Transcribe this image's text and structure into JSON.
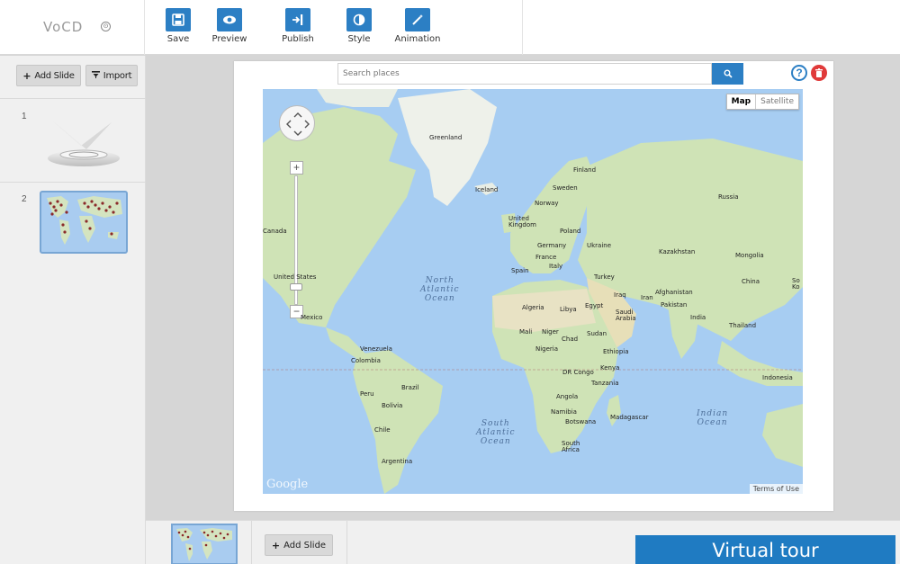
{
  "app": {
    "logo_text": "VoCD",
    "logo_caret": "⊙"
  },
  "toolbar": {
    "save_label": "Save",
    "preview_label": "Preview",
    "publish_label": "Publish",
    "style_label": "Style",
    "animation_label": "Animation"
  },
  "sidebar": {
    "add_slide_label": "Add Slide",
    "import_label": "Import",
    "slides": [
      {
        "number": "1"
      },
      {
        "number": "2"
      }
    ]
  },
  "map_editor": {
    "search_placeholder": "Search places",
    "help_label": "?",
    "map_type": {
      "map": "Map",
      "satellite": "Satellite"
    },
    "zoom_in": "+",
    "zoom_out": "−",
    "google": "Google",
    "terms": "Terms of Use",
    "countries": {
      "greenland": "Greenland",
      "iceland": "Iceland",
      "finland": "Finland",
      "sweden": "Sweden",
      "norway": "Norway",
      "russia": "Russia",
      "uk": "United\nKingdom",
      "poland": "Poland",
      "germany": "Germany",
      "ukraine": "Ukraine",
      "france": "France",
      "spain": "Spain",
      "italy": "Italy",
      "turkey": "Turkey",
      "kazakhstan": "Kazakhstan",
      "mongolia": "Mongolia",
      "china": "China",
      "south_korea": "So\nKo",
      "afghanistan": "Afghanistan",
      "iraq": "Iraq",
      "iran": "Iran",
      "pakistan": "Pakistan",
      "india": "India",
      "thailand": "Thailand",
      "indonesia": "Indonesia",
      "canada": "Canada",
      "united_states": "United States",
      "mexico": "Mexico",
      "venezuela": "Venezuela",
      "colombia": "Colombia",
      "peru": "Peru",
      "brazil": "Brazil",
      "bolivia": "Bolivia",
      "chile": "Chile",
      "argentina": "Argentina",
      "algeria": "Algeria",
      "libya": "Libya",
      "egypt": "Egypt",
      "saudi_arabia": "Saudi\nArabia",
      "mali": "Mali",
      "niger": "Niger",
      "chad": "Chad",
      "sudan": "Sudan",
      "nigeria": "Nigeria",
      "ethiopia": "Ethiopia",
      "dr_congo": "DR Congo",
      "kenya": "Kenya",
      "tanzania": "Tanzania",
      "angola": "Angola",
      "namibia": "Namibia",
      "botswana": "Botswana",
      "madagascar": "Madagascar",
      "south_africa": "South\nAfrica"
    },
    "oceans": {
      "north_atlantic": "North\nAtlantic\nOcean",
      "south_atlantic": "South\nAtlantic\nOcean",
      "indian": "Indian\nOcean"
    }
  },
  "bottom": {
    "add_slide_label": "Add Slide"
  },
  "banner": {
    "text": "Virtual tour"
  },
  "colors": {
    "accent": "#2c7fc4",
    "delete": "#e03a3a",
    "water": "#a7cdf2",
    "land": "#cfe3b6",
    "banner": "#1f7bc2"
  }
}
